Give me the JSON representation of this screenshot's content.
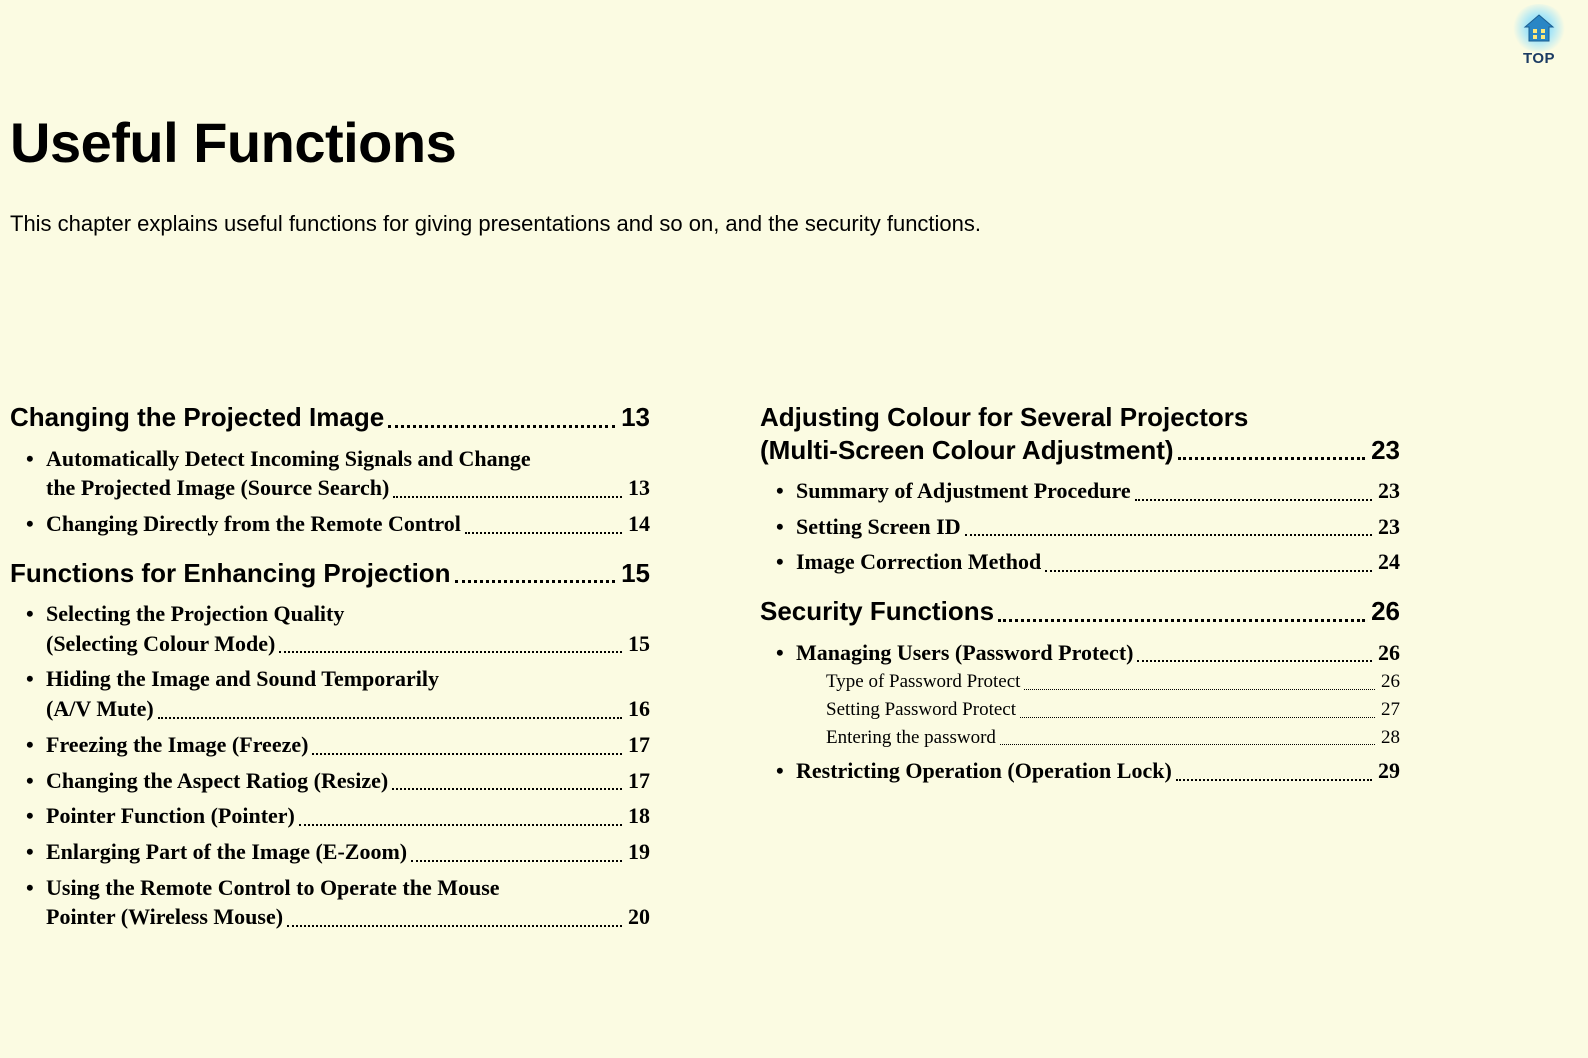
{
  "topIcon": {
    "label": "TOP"
  },
  "title": "Useful Functions",
  "intro": "This chapter explains useful functions for giving presentations and so on, and the security functions.",
  "left": {
    "sections": [
      {
        "heading": "Changing the Projected Image",
        "page": "13",
        "items": [
          {
            "line1": "Automatically Detect Incoming Signals and Change",
            "line2": "the Projected Image (Source Search)",
            "page": "13"
          },
          {
            "line1": "Changing Directly from the Remote Control",
            "page": "14"
          }
        ]
      },
      {
        "heading": "Functions for Enhancing Projection",
        "page": "15",
        "items": [
          {
            "line1": "Selecting the Projection Quality",
            "line2": "(Selecting Colour Mode)",
            "page": "15"
          },
          {
            "line1": "Hiding the Image and Sound Temporarily",
            "line2": "(A/V Mute)",
            "page": "16"
          },
          {
            "line1": "Freezing the Image (Freeze)",
            "page": "17"
          },
          {
            "line1": "Changing the Aspect Ratiog (Resize)",
            "page": "17"
          },
          {
            "line1": "Pointer Function (Pointer)",
            "page": "18"
          },
          {
            "line1": "Enlarging Part of the Image (E-Zoom)",
            "page": "19"
          },
          {
            "line1": "Using the Remote Control to Operate the Mouse",
            "line2": "Pointer (Wireless Mouse)",
            "page": "20"
          }
        ]
      }
    ]
  },
  "right": {
    "sections": [
      {
        "headingLine1": "Adjusting Colour for Several Projectors",
        "headingLine2": "(Multi-Screen Colour Adjustment)",
        "page": "23",
        "items": [
          {
            "line1": "Summary of Adjustment Procedure",
            "page": "23"
          },
          {
            "line1": "Setting Screen ID",
            "page": "23"
          },
          {
            "line1": "Image Correction Method",
            "page": "24"
          }
        ]
      },
      {
        "heading": "Security Functions",
        "page": "26",
        "items": [
          {
            "line1": "Managing Users (Password Protect)",
            "page": "26",
            "sub": [
              {
                "label": "Type of Password Protect",
                "page": "26"
              },
              {
                "label": "Setting Password Protect",
                "page": "27"
              },
              {
                "label": "Entering the password",
                "page": "28"
              }
            ]
          },
          {
            "line1": "Restricting Operation (Operation Lock)",
            "page": "29"
          }
        ]
      }
    ]
  }
}
